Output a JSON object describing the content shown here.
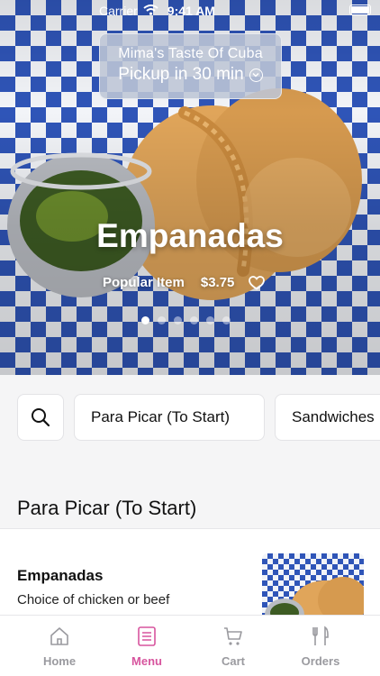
{
  "status": {
    "carrier": "Carrier",
    "time": "9:41 AM"
  },
  "store": {
    "name": "Mima's Taste Of Cuba",
    "pickup": "Pickup in 30 min"
  },
  "hero": {
    "title": "Empanadas",
    "tag": "Popular Item",
    "price": "$3.75",
    "slide_count": 6,
    "active_slide": 1
  },
  "categories": [
    "Para Picar (To Start)",
    "Sandwiches"
  ],
  "section": {
    "title": "Para Picar (To Start)"
  },
  "items": [
    {
      "name": "Empanadas",
      "description": "Choice of chicken or beef"
    }
  ],
  "tabs": [
    {
      "label": "Home",
      "icon": "home-icon"
    },
    {
      "label": "Menu",
      "icon": "menu-icon"
    },
    {
      "label": "Cart",
      "icon": "cart-icon"
    },
    {
      "label": "Orders",
      "icon": "orders-icon"
    }
  ],
  "active_tab": "Menu",
  "colors": {
    "accent": "#d7559e",
    "checker": "#2f55b8"
  }
}
